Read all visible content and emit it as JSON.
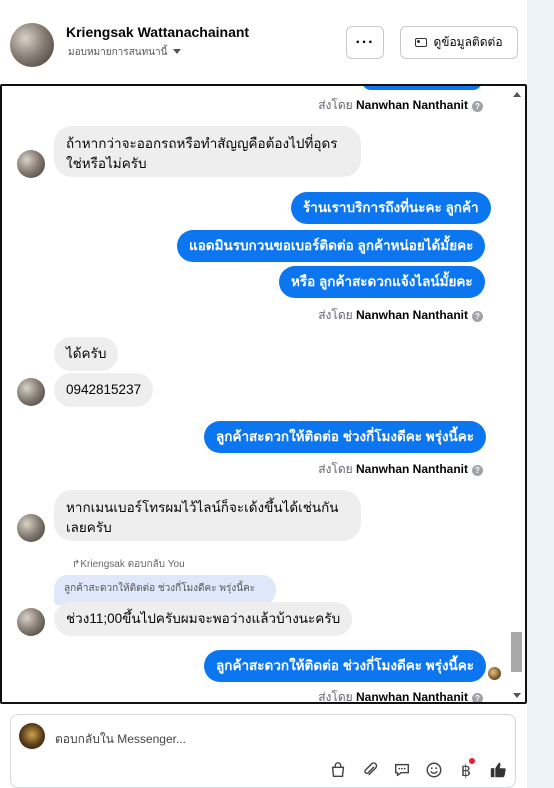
{
  "header": {
    "name": "Kriengsak Wattanachainant",
    "assign_label": "มอบหมายการสนทนานี้",
    "more_label": "···",
    "info_button": "ดูข้อมูลติดต่อ"
  },
  "sent_by": {
    "prefix": "ส่งโดย",
    "agent": "Nanwhan Nanthanit"
  },
  "messages": [
    {
      "dir": "in",
      "text": "ถ้าหากว่าจะออกรถหรือทำสัญญคือต้องไปที่อุดรใช่หรือไม่ครับ"
    },
    {
      "dir": "out",
      "text": "ร้านเราบริการถึงที่นะคะ ลูกค้า"
    },
    {
      "dir": "out",
      "text": "แอดมินรบกวนขอเบอร์ติดต่อ ลูกค้าหน่อยได้มั้ยคะ"
    },
    {
      "dir": "out",
      "text": "หรือ ลูกค้าสะดวกแจ้งไลน์มั้ยคะ"
    },
    {
      "dir": "in",
      "text": "ได้ครับ"
    },
    {
      "dir": "in",
      "text": "0942815237"
    },
    {
      "dir": "out",
      "text": "ลูกค้าสะดวกให้ติดต่อ ช่วงกี่โมงดีคะ พรุ่งนี้คะ"
    },
    {
      "dir": "in",
      "text": "หากเมนเบอร์โทรผมไว้ไลน์ก็จะเด้งขึ้นได้เช่นกันเลยครับ"
    },
    {
      "dir": "in",
      "text": "ช่วง11;00ขึ้นไปครับผมจะพอว่างแล้วบ้างนะครับ"
    },
    {
      "dir": "out",
      "text": "ลูกค้าสะดวกให้ติดต่อ ช่วงกี่โมงดีคะ พรุ่งนี้คะ"
    }
  ],
  "reply": {
    "label": "↱Kriengsak ตอบกลับ You",
    "quote": "ลูกค้าสะดวกให้ติดต่อ ช่วงกี่โมงดีคะ พรุ่งนี้คะ"
  },
  "composer": {
    "placeholder": "ตอบกลับใน Messenger..."
  },
  "icons": [
    "shopping-bag-icon",
    "paperclip-icon",
    "saved-reply-icon",
    "emoji-icon",
    "payment-icon",
    "like-icon"
  ],
  "colors": {
    "outgoing": "#0c76f0",
    "incoming": "#eeeeee"
  }
}
